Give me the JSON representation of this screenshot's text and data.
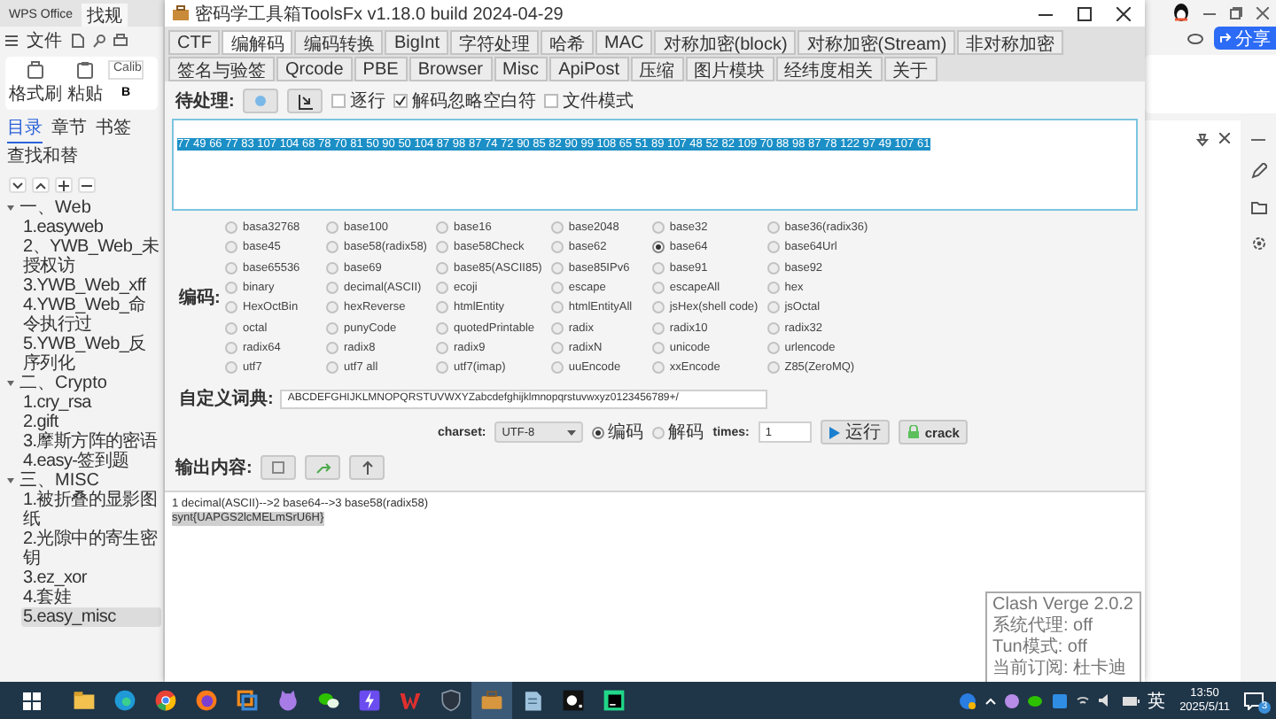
{
  "wps": {
    "tabs": [
      {
        "label": "WPS Office",
        "selected": false
      },
      {
        "label": "找规",
        "selected": true
      }
    ],
    "file_menu": "文件",
    "ribbon": {
      "format_painter": "格式刷",
      "paste": "粘贴",
      "font": "Calib",
      "bold": "B"
    },
    "nav_tabs": [
      {
        "label": "目录",
        "selected": true
      },
      {
        "label": "章节",
        "selected": false
      },
      {
        "label": "书签",
        "selected": false
      },
      {
        "label": "查找和替",
        "selected": false
      }
    ],
    "outline": [
      {
        "label": "一、Web",
        "expanded": true,
        "children": [
          {
            "label": "1.easyweb",
            "selected": false
          },
          {
            "label": "2、YWB_Web_未授权访",
            "selected": false
          },
          {
            "label": "3.YWB_Web_xff",
            "selected": false
          },
          {
            "label": "4.YWB_Web_命令执行过",
            "selected": false
          },
          {
            "label": "5.YWB_Web_反序列化",
            "selected": false
          }
        ]
      },
      {
        "label": "二、Crypto",
        "expanded": true,
        "children": [
          {
            "label": "1.cry_rsa",
            "selected": false
          },
          {
            "label": "2.gift",
            "selected": false
          },
          {
            "label": "3.摩斯方阵的密语",
            "selected": false
          },
          {
            "label": "4.easy-签到题",
            "selected": false
          }
        ]
      },
      {
        "label": "三、MISC",
        "expanded": true,
        "children": [
          {
            "label": "1.被折叠的显影图纸",
            "selected": false
          },
          {
            "label": "2.光隙中的寄生密钥",
            "selected": false
          },
          {
            "label": "3.ez_xor",
            "selected": false
          },
          {
            "label": "4.套娃",
            "selected": false
          },
          {
            "label": "5.easy_misc",
            "selected": true
          }
        ]
      }
    ],
    "share_button": "分享"
  },
  "tools": {
    "title": "密码学工具箱ToolsFx v1.18.0 build 2024-04-29",
    "tabs": [
      {
        "label": "CTF",
        "selected": false
      },
      {
        "label": "编解码",
        "selected": true
      },
      {
        "label": "编码转换",
        "selected": false
      },
      {
        "label": "BigInt",
        "selected": false
      },
      {
        "label": "字符处理",
        "selected": false
      },
      {
        "label": "哈希",
        "selected": false
      },
      {
        "label": "MAC",
        "selected": false
      },
      {
        "label": "对称加密(block)",
        "selected": false
      },
      {
        "label": "对称加密(Stream)",
        "selected": false
      },
      {
        "label": "非对称加密",
        "selected": false
      },
      {
        "label": "签名与验签",
        "selected": false
      },
      {
        "label": "Qrcode",
        "selected": false
      },
      {
        "label": "PBE",
        "selected": false
      },
      {
        "label": "Browser",
        "selected": false
      },
      {
        "label": "Misc",
        "selected": false
      },
      {
        "label": "ApiPost",
        "selected": false
      },
      {
        "label": "压缩",
        "selected": false
      },
      {
        "label": "图片模块",
        "selected": false
      },
      {
        "label": "经纬度相关",
        "selected": false
      },
      {
        "label": "关于",
        "selected": false
      }
    ],
    "input": {
      "label": "待处理:",
      "options": [
        {
          "label": "逐行",
          "checked": false
        },
        {
          "label": "解码忽略空白符",
          "checked": true
        },
        {
          "label": "文件模式",
          "checked": false
        }
      ],
      "value": "77 49 66 77 83 107 104 68 78 70 81 50 90 50 104 87 98 87 74 72 90 85 82 90 99 108 65 51 89 107 48 52 82 109 70 88 98 87 78 122 97 49 107 61"
    },
    "encoding": {
      "label": "编码:",
      "options": [
        {
          "label": "basa32768",
          "selected": false
        },
        {
          "label": "base100",
          "selected": false
        },
        {
          "label": "base16",
          "selected": false
        },
        {
          "label": "base2048",
          "selected": false
        },
        {
          "label": "base32",
          "selected": false
        },
        {
          "label": "base36(radix36)",
          "selected": false
        },
        {
          "label": "base45",
          "selected": false
        },
        {
          "label": "base58(radix58)",
          "selected": false
        },
        {
          "label": "base58Check",
          "selected": false
        },
        {
          "label": "base62",
          "selected": false
        },
        {
          "label": "base64",
          "selected": true
        },
        {
          "label": "base64Url",
          "selected": false
        },
        {
          "label": "base65536",
          "selected": false
        },
        {
          "label": "base69",
          "selected": false
        },
        {
          "label": "base85(ASCII85)",
          "selected": false
        },
        {
          "label": "base85IPv6",
          "selected": false
        },
        {
          "label": "base91",
          "selected": false
        },
        {
          "label": "base92",
          "selected": false
        },
        {
          "label": "binary",
          "selected": false
        },
        {
          "label": "decimal(ASCII)",
          "selected": false
        },
        {
          "label": "ecoji",
          "selected": false
        },
        {
          "label": "escape",
          "selected": false
        },
        {
          "label": "escapeAll",
          "selected": false
        },
        {
          "label": "hex",
          "selected": false
        },
        {
          "label": "HexOctBin",
          "selected": false
        },
        {
          "label": "hexReverse",
          "selected": false
        },
        {
          "label": "htmlEntity",
          "selected": false
        },
        {
          "label": "htmlEntityAll",
          "selected": false
        },
        {
          "label": "jsHex(shell code)",
          "selected": false
        },
        {
          "label": "jsOctal",
          "selected": false
        },
        {
          "label": "octal",
          "selected": false
        },
        {
          "label": "punyCode",
          "selected": false
        },
        {
          "label": "quotedPrintable",
          "selected": false
        },
        {
          "label": "radix",
          "selected": false
        },
        {
          "label": "radix10",
          "selected": false
        },
        {
          "label": "radix32",
          "selected": false
        },
        {
          "label": "radix64",
          "selected": false
        },
        {
          "label": "radix8",
          "selected": false
        },
        {
          "label": "radix9",
          "selected": false
        },
        {
          "label": "radixN",
          "selected": false
        },
        {
          "label": "unicode",
          "selected": false
        },
        {
          "label": "urlencode",
          "selected": false
        },
        {
          "label": "utf7",
          "selected": false
        },
        {
          "label": "utf7 all",
          "selected": false
        },
        {
          "label": "utf7(imap)",
          "selected": false
        },
        {
          "label": "uuEncode",
          "selected": false
        },
        {
          "label": "xxEncode",
          "selected": false
        },
        {
          "label": "Z85(ZeroMQ)",
          "selected": false
        }
      ]
    },
    "dictionary": {
      "label": "自定义词典:",
      "value": "ABCDEFGHIJKLMNOPQRSTUVWXYZabcdefghijklmnopqrstuvwxyz0123456789+/"
    },
    "charset": {
      "label": "charset:",
      "value": "UTF-8"
    },
    "modes": [
      {
        "label": "编码",
        "selected": true
      },
      {
        "label": "解码",
        "selected": false
      }
    ],
    "times": {
      "label": "times:",
      "value": "1"
    },
    "run_button": "运行",
    "crack_button": "crack",
    "output": {
      "label": "输出内容:",
      "lines": [
        {
          "text": "1 decimal(ASCII)-->2 base64-->3 base58(radix58)",
          "selected": false
        },
        {
          "text": "synt{UAPGS2lcMELmSrU6H}",
          "selected": true
        }
      ]
    }
  },
  "clash_tooltip": [
    "Clash Verge 2.0.2",
    "系统代理: off",
    "Tun模式: off",
    "当前订阅: 杜卡迪"
  ],
  "taskbar": {
    "apps": [
      {
        "kind": "folder",
        "active": false
      },
      {
        "kind": "edge",
        "active": false
      },
      {
        "kind": "chrome",
        "active": false
      },
      {
        "kind": "firefox",
        "active": false
      },
      {
        "kind": "vmware",
        "active": false
      },
      {
        "kind": "cat",
        "active": false
      },
      {
        "kind": "chat",
        "active": false
      },
      {
        "kind": "bolt",
        "active": false
      },
      {
        "kind": "zigzag",
        "active": false
      },
      {
        "kind": "shield",
        "active": false
      },
      {
        "kind": "toolbox",
        "active": true
      },
      {
        "kind": "notes",
        "active": false
      },
      {
        "kind": "dark",
        "active": false
      },
      {
        "kind": "ide",
        "active": false
      }
    ],
    "ime": "英",
    "time": "13:50",
    "date": "2025/5/11",
    "notifications": "3"
  }
}
